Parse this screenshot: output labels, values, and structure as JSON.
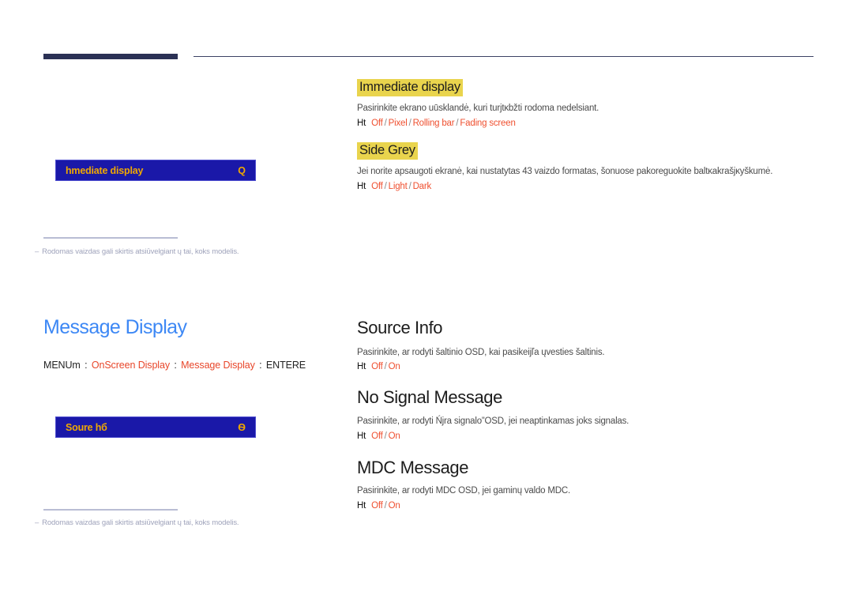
{
  "page": {
    "footnote_dash": "–",
    "footnote": "Rodomas vaizdas gali skirtis atsiūvelgiant ų tai, koks modelis."
  },
  "block_top": {
    "osd_panel": {
      "label": "hmediate display",
      "value": "Q"
    },
    "items": [
      {
        "heading": "Immediate display",
        "heading_style": "highlight",
        "description": "Pasirinkite ekrano uūsklandė, kuri turjtĸbžti rodoma nedelsiant.",
        "marker": "Ht",
        "options": [
          "Off",
          "Pixel",
          "Rolling bar",
          "Fading screen"
        ]
      },
      {
        "heading": "Side Grey",
        "heading_style": "highlight",
        "description": "Jei norite apsaugoti ekranė, kai nustatytas 43 vaizdo formatas, šonuose pakoreguokite baltĸakrašjĸyškumė.",
        "marker": "Ht",
        "options": [
          "Off",
          "Light",
          "Dark"
        ]
      }
    ]
  },
  "block_bottom": {
    "title": "Message Display",
    "breadcrumb": {
      "prefix": "MENUm",
      "sep": ":",
      "crumb1": "OnScreen Display",
      "crumb2": "Message Display",
      "suffix": "ENTERE"
    },
    "osd_panel": {
      "label": "Soure hб",
      "value": "Ѳ"
    },
    "items": [
      {
        "heading": "Source Info",
        "heading_style": "plain",
        "description": "Pasirinkite, ar rodyti šaltinio OSD, kai pasikeijľa ųvesties šaltinis.",
        "marker": "Ht",
        "options": [
          "Off",
          "On"
        ]
      },
      {
        "heading": "No Signal Message",
        "heading_style": "plain",
        "description": "Pasirinkite, ar rodyti Ńjra signalo”OSD, jei neaptinkamas joks signalas.",
        "marker": "Ht",
        "options": [
          "Off",
          "On"
        ]
      },
      {
        "heading": "MDC Message",
        "heading_style": "plain",
        "description": "Pasirinkite, ar rodyti MDC OSD, jei gaminų valdo MDC.",
        "marker": "Ht",
        "options": [
          "Off",
          "On"
        ]
      }
    ]
  },
  "colors": {
    "rule_dark": "#2b3155",
    "highlight_yellow": "#e9d44d",
    "osd_blue": "#1a18a8",
    "osd_gold": "#f0a800",
    "title_blue": "#3d88f5",
    "option_red": "#ef5030",
    "crumb_red": "#e8462a",
    "footnote_gray": "#9fa3bb"
  }
}
